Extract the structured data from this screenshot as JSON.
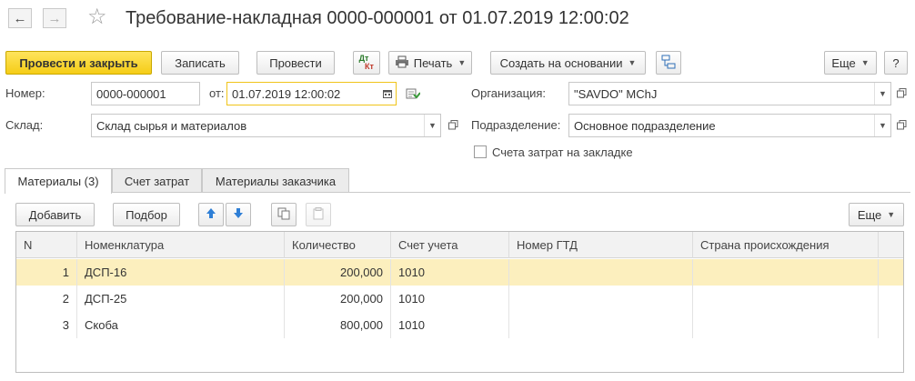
{
  "window": {
    "title": "Требование-накладная 0000-000001 от 01.07.2019 12:00:02"
  },
  "toolbar": {
    "post_close": "Провести и закрыть",
    "save": "Записать",
    "post": "Провести",
    "dtkt_top": "Дт",
    "dtkt_bottom": "Кт",
    "print": "Печать",
    "create_based": "Создать на основании",
    "more": "Еще",
    "help": "?"
  },
  "form": {
    "number_label": "Номер:",
    "number_value": "0000-000001",
    "date_label": "от:",
    "date_value": "01.07.2019 12:00:02",
    "org_label": "Организация:",
    "org_value": "\"SAVDO\" MChJ",
    "warehouse_label": "Склад:",
    "warehouse_value": "Склад сырья и материалов",
    "division_label": "Подразделение:",
    "division_value": "Основное подразделение",
    "cost_accounts_checkbox": "Счета затрат на закладке",
    "cost_accounts_checked": false
  },
  "tabs": [
    {
      "label": "Материалы (3)",
      "active": true
    },
    {
      "label": "Счет затрат",
      "active": false
    },
    {
      "label": "Материалы заказчика",
      "active": false
    }
  ],
  "table_toolbar": {
    "add": "Добавить",
    "pick": "Подбор",
    "more": "Еще"
  },
  "table": {
    "columns": [
      "N",
      "Номенклатура",
      "Количество",
      "Счет учета",
      "Номер ГТД",
      "Страна происхождения"
    ],
    "rows": [
      {
        "n": "1",
        "item": "ДСП-16",
        "qty": "200,000",
        "account": "1010",
        "gtd": "",
        "country": ""
      },
      {
        "n": "2",
        "item": "ДСП-25",
        "qty": "200,000",
        "account": "1010",
        "gtd": "",
        "country": ""
      },
      {
        "n": "3",
        "item": "Скоба",
        "qty": "800,000",
        "account": "1010",
        "gtd": "",
        "country": ""
      }
    ],
    "selected_row": 1
  },
  "colors": {
    "primary_button": "#f5cd17",
    "selected_row": "#fcefbe",
    "focus_border": "#f0c419",
    "arrow_blue": "#2f7fd6"
  }
}
